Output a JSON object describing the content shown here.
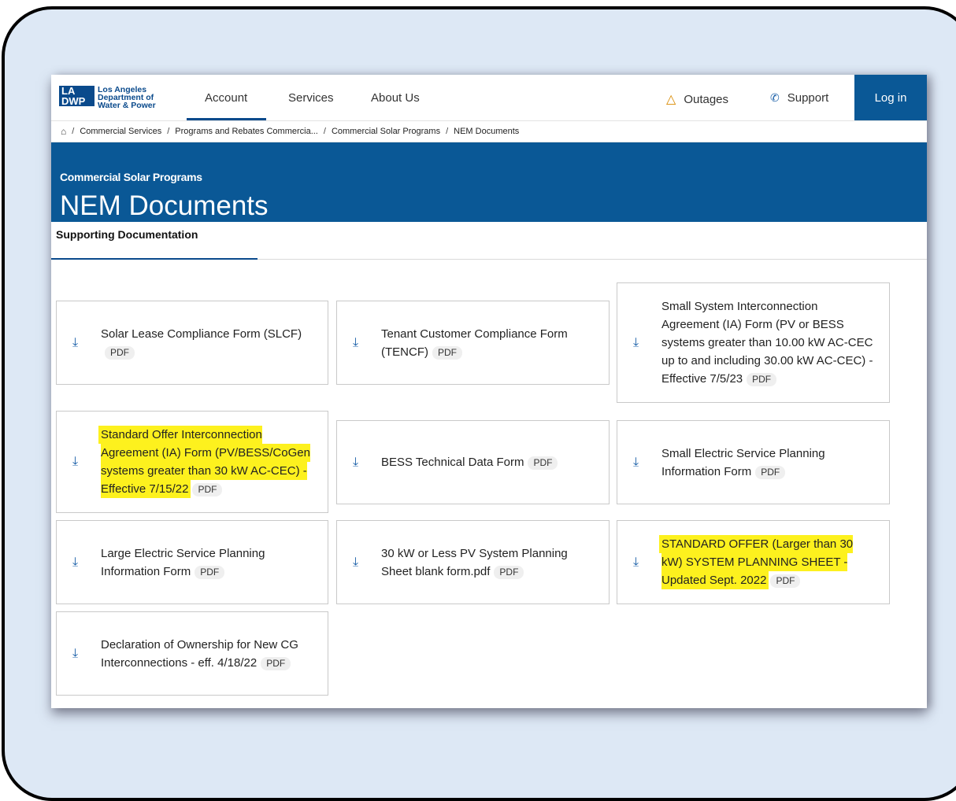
{
  "brand": {
    "box_line1": "LA",
    "box_line2": "DWP",
    "text_line1": "Los Angeles",
    "text_line2": "Department of",
    "text_line3": "Water & Power"
  },
  "nav": {
    "account": "Account",
    "services": "Services",
    "about": "About Us",
    "outages": "Outages",
    "support": "Support",
    "login": "Log in"
  },
  "breadcrumb": [
    "Commercial Services",
    "Programs and Rebates Commercia...",
    "Commercial Solar Programs",
    "NEM Documents"
  ],
  "hero": {
    "eyebrow": "Commercial Solar Programs",
    "title": "NEM Documents"
  },
  "tabs": {
    "active": "Supporting Documentation"
  },
  "pdf_badge": "PDF",
  "documents": [
    {
      "title": "Solar Lease Compliance Form (SLCF)",
      "highlighted": false
    },
    {
      "title": "Tenant Customer Compliance Form (TENCF)",
      "highlighted": false
    },
    {
      "title": "Small System Interconnection Agreement (IA) Form (PV or BESS systems greater than 10.00 kW AC-CEC up to and including 30.00 kW AC-CEC) - Effective 7/5/23",
      "highlighted": false
    },
    {
      "title": "Standard Offer Interconnection Agreement (IA) Form (PV/BESS/CoGen systems greater than 30 kW AC-CEC) - Effective 7/15/22",
      "highlighted": true
    },
    {
      "title": "BESS Technical Data Form",
      "highlighted": false
    },
    {
      "title": "Small Electric Service Planning Information Form",
      "highlighted": false
    },
    {
      "title": "Large Electric Service Planning Information Form",
      "highlighted": false
    },
    {
      "title": "30 kW or Less PV System Planning Sheet blank form.pdf",
      "highlighted": false
    },
    {
      "title": "STANDARD OFFER (Larger than 30 kW) SYSTEM PLANNING SHEET - Updated Sept. 2022",
      "highlighted": true
    },
    {
      "title": "Declaration of Ownership for New CG Interconnections - eff. 4/18/22",
      "highlighted": false
    }
  ],
  "colors": {
    "brand_blue": "#0a5896",
    "highlight": "#fdf11e",
    "link_blue": "#1a5fa8"
  }
}
